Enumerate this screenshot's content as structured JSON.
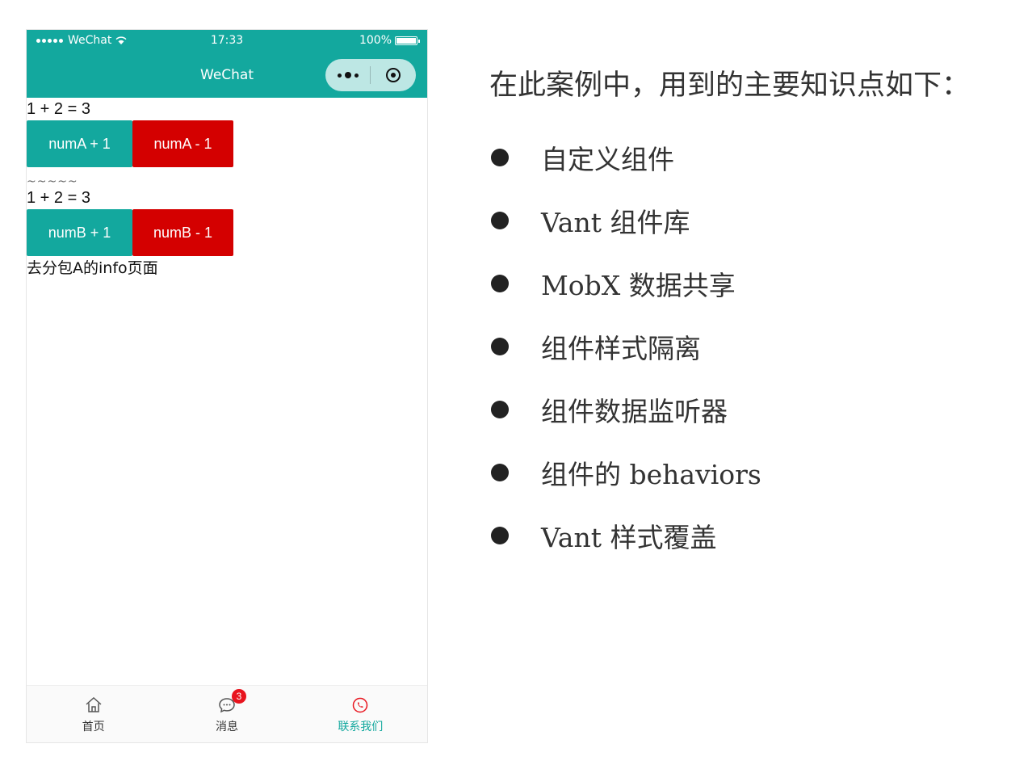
{
  "phone": {
    "status_bar": {
      "carrier": "WeChat",
      "time": "17:33",
      "battery": "100%"
    },
    "nav_bar": {
      "title": "WeChat"
    },
    "content": {
      "eq_a": "1 + 2 = 3",
      "btn_a_plus": "numA + 1",
      "btn_a_minus": "numA - 1",
      "separator": "~~~~~",
      "eq_b": "1 + 2 = 3",
      "btn_b_plus": "numB + 1",
      "btn_b_minus": "numB - 1",
      "link": "去分包A的info页面"
    },
    "tab_bar": {
      "tabs": [
        {
          "label": "首页",
          "icon": "home-icon"
        },
        {
          "label": "消息",
          "icon": "message-icon",
          "badge": "3"
        },
        {
          "label": "联系我们",
          "icon": "phone-icon",
          "active": true
        }
      ]
    },
    "colors": {
      "primary": "#13a89e",
      "danger": "#d40000",
      "badge": "#e8141e"
    }
  },
  "notes": {
    "heading": "在此案例中，用到的主要知识点如下：",
    "items": [
      "自定义组件",
      "Vant 组件库",
      "MobX 数据共享",
      "组件样式隔离",
      "组件数据监听器",
      "组件的 behaviors",
      "Vant 样式覆盖"
    ]
  }
}
